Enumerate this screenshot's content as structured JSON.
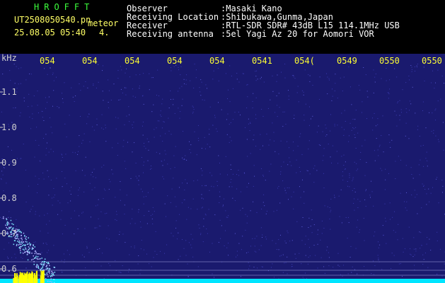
{
  "header": {
    "logo": "HROFFT",
    "file_name": "UT2508050540.pn",
    "category": "meteor",
    "datetime": "25.08.05 05:40",
    "count": "4.",
    "info_labels": [
      "Observer",
      "Receiving Location",
      "Receiver",
      "Receiving antenna"
    ],
    "info_values": [
      ":Masaki Kano",
      ":Shibukawa,Gunma,Japan",
      ":RTL-SDR SDR# 43dB L15 114.1MHz USB",
      ":5el Yagi Az 20 for Aomori VOR"
    ]
  },
  "colors": {
    "background": "#000000",
    "plot_background": "#1a1a6e",
    "noise_speck": "#3a3ab0",
    "header_text": "#ffffff",
    "logo_green": "#3cff3c",
    "tick_yellow": "#ffff33",
    "baseline_cyan": "#00e5ff",
    "signal_yellow": "#ffff00",
    "meteor_cyan": "#7fe8ff"
  },
  "chart_data": {
    "type": "heatmap",
    "ylabel": "kHz",
    "time_ticks": [
      "054",
      "054",
      "054",
      "054",
      "054",
      "054",
      "054",
      "054",
      "054",
      "0550"
    ],
    "time_ticks_display": [
      "054",
      "054",
      "054",
      "054",
      "054",
      "0541",
      "054(",
      "0549",
      "0550"
    ],
    "freq_ticks": [
      "1.1",
      "1.0",
      "0.9",
      "0.8",
      "0.7",
      "0.6"
    ],
    "freq_ticks_khz": [
      1.1,
      1.0,
      0.9,
      0.8,
      0.7,
      0.6
    ],
    "ylim": [
      0.57,
      1.15
    ]
  }
}
